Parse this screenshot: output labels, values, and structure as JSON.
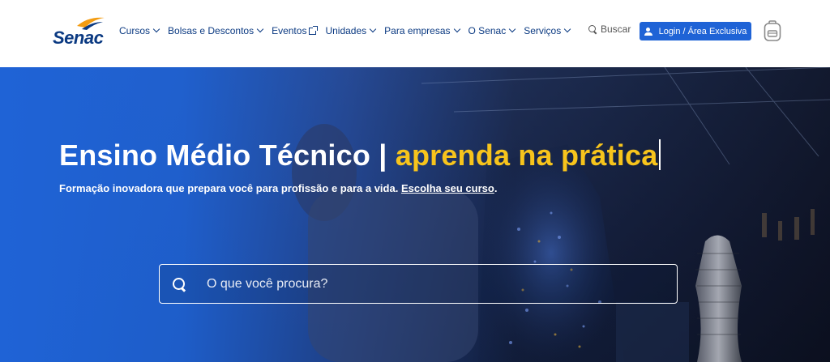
{
  "header": {
    "logo_text": "Senac",
    "nav": [
      {
        "label": "Cursos",
        "icon": "chevron-down-icon"
      },
      {
        "label": "Bolsas e Descontos",
        "icon": "chevron-down-icon"
      },
      {
        "label": "Eventos",
        "icon": "external-link-icon"
      },
      {
        "label": "Unidades",
        "icon": "chevron-down-icon"
      },
      {
        "label": "Para empresas",
        "icon": "chevron-down-icon"
      },
      {
        "label": "O Senac",
        "icon": "chevron-down-icon"
      },
      {
        "label": "Serviços",
        "icon": "chevron-down-icon"
      }
    ],
    "search_label": "Buscar",
    "login_label": "Login / Área Exclusiva"
  },
  "hero": {
    "title_main": "Ensino Médio Técnico | ",
    "title_accent": "aprenda na prática",
    "subtitle": "Formação inovadora que prepara você para profissão e para a vida. ",
    "subtitle_link": "Escolha seu curso",
    "subtitle_end": ".",
    "search_placeholder": "O que você procura?"
  },
  "colors": {
    "brand_blue": "#0b3a82",
    "button_blue": "#1f63d6",
    "accent_yellow": "#f7c41c",
    "logo_orange": "#f39c12"
  }
}
